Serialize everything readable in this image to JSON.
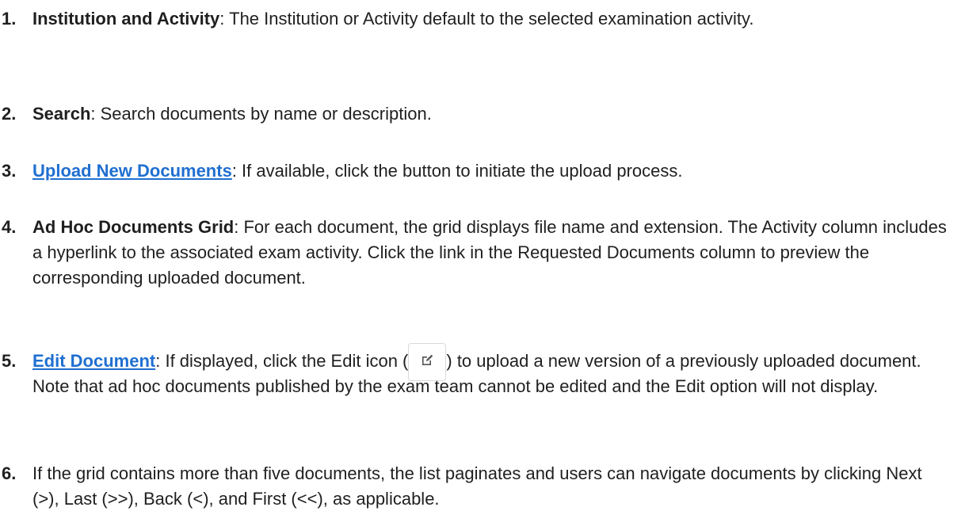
{
  "items": [
    {
      "number": "1.",
      "term": "Institution and Activity",
      "text": ": The Institution or Activity default to the selected examination activity."
    },
    {
      "number": "2.",
      "term": "Search",
      "text": ": Search documents by name or description."
    },
    {
      "number": "3.",
      "link": "Upload New Documents",
      "text": ": If available, click the button to initiate the upload process."
    },
    {
      "number": "4.",
      "term": "Ad Hoc Documents Grid",
      "text": ": For each document, the grid displays file name and extension.  The Activity column includes a hyperlink to the associated exam activity.  Click the link in the Requested Documents column to preview the corresponding uploaded document."
    },
    {
      "number": "5.",
      "link": "Edit Document",
      "text_before": ":  If displayed, click the Edit icon (",
      "icon": "edit-icon",
      "text_after": ") to upload a new version of a previously uploaded document.  Note that ad hoc documents published by the exam team cannot be edited and the Edit option will not display."
    },
    {
      "number": "6.",
      "text": "If the grid contains more than five documents, the list paginates and users can navigate documents by clicking Next (>), Last (>>), Back (<), and First (<<), as applicable."
    }
  ],
  "colors": {
    "link": "#1f6fd0",
    "text": "#1f1f1f"
  }
}
